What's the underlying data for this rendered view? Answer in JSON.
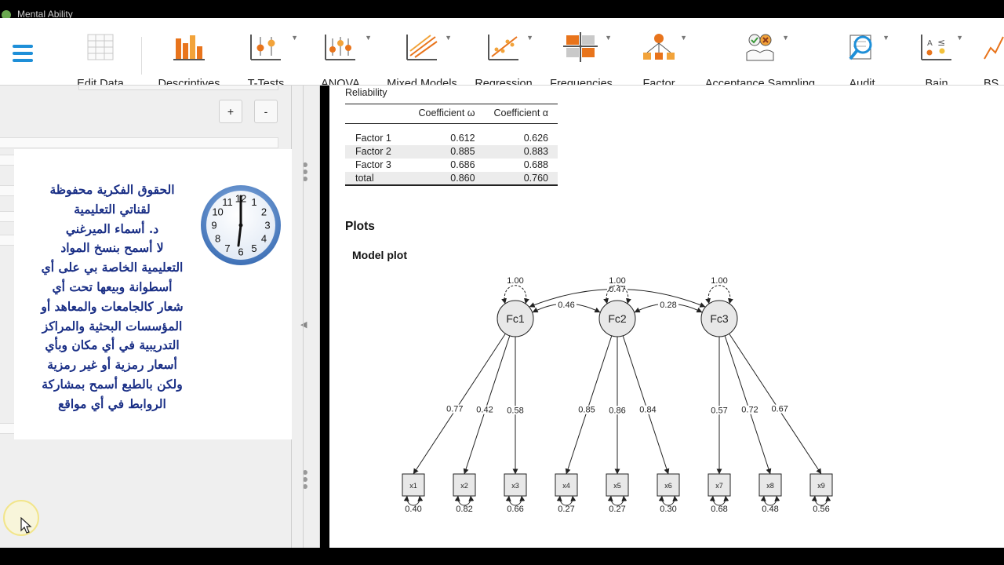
{
  "window": {
    "title": "Mental Ability"
  },
  "ribbon": {
    "edit_data": "Edit Data",
    "items": [
      {
        "key": "descriptives",
        "label": "Descriptives",
        "has_caret": false
      },
      {
        "key": "t-tests",
        "label": "T-Tests",
        "has_caret": true
      },
      {
        "key": "anova",
        "label": "ANOVA",
        "has_caret": true
      },
      {
        "key": "mixed-models",
        "label": "Mixed Models",
        "has_caret": true
      },
      {
        "key": "regression",
        "label": "Regression",
        "has_caret": true
      },
      {
        "key": "frequencies",
        "label": "Frequencies",
        "has_caret": true
      },
      {
        "key": "factor",
        "label": "Factor",
        "has_caret": true
      },
      {
        "key": "acceptance-sampling",
        "label": "Acceptance Sampling",
        "has_caret": true
      },
      {
        "key": "audit",
        "label": "Audit",
        "has_caret": true
      },
      {
        "key": "bain",
        "label": "Bain",
        "has_caret": true
      },
      {
        "key": "bsts",
        "label": "BS",
        "has_caret": false
      }
    ],
    "accent_color": "#1e8fd8",
    "icon_orange": "#e8741c"
  },
  "left_panel": {
    "plus_label": "+",
    "minus_label": "-",
    "overlay_lines": [
      "الحقوق الفكرية محفوظة",
      "لقناتي التعليمية",
      "د. أسماء الميرغني",
      "لا أسمح بنسخ المواد",
      "التعليمية الخاصة بي على أي",
      "أسطوانة وبيعها تحت أي",
      "شعار كالجامعات والمعاهد أو",
      "المؤسسات البحثية والمراكز",
      "التدريبية في أي مكان وبأي",
      "أسعار رمزية أو غير رمزية",
      "ولكن بالطبع أسمح بمشاركة",
      "الروابط في أي مواقع"
    ],
    "overlay_color": "#1a2f86",
    "clock_numbers": [
      "12",
      "1",
      "2",
      "3",
      "4",
      "5",
      "6",
      "7",
      "8",
      "9",
      "10",
      "11"
    ]
  },
  "results": {
    "table_title": "Reliability",
    "columns": [
      "",
      "Coefficient ω",
      "Coefficient α"
    ],
    "rows": [
      {
        "name": "Factor 1",
        "omega": "0.612",
        "alpha": "0.626"
      },
      {
        "name": "Factor 2",
        "omega": "0.885",
        "alpha": "0.883"
      },
      {
        "name": "Factor 3",
        "omega": "0.686",
        "alpha": "0.688"
      },
      {
        "name": "total",
        "omega": "0.860",
        "alpha": "0.760"
      }
    ],
    "plots_heading": "Plots",
    "model_plot_heading": "Model plot"
  },
  "model": {
    "factors": [
      {
        "id": "Fc1",
        "variance": "1.00"
      },
      {
        "id": "Fc2",
        "variance": "1.00"
      },
      {
        "id": "Fc3",
        "variance": "1.00"
      }
    ],
    "covariances": [
      {
        "from": "Fc1",
        "to": "Fc2",
        "value": "0.46"
      },
      {
        "from": "Fc2",
        "to": "Fc3",
        "value": "0.28"
      },
      {
        "from": "Fc1",
        "to": "Fc3",
        "value": "0.47"
      }
    ],
    "indicators": [
      {
        "id": "x1",
        "factor": "Fc1",
        "loading": "0.77",
        "residual": "0.40"
      },
      {
        "id": "x2",
        "factor": "Fc1",
        "loading": "0.42",
        "residual": "0.82"
      },
      {
        "id": "x3",
        "factor": "Fc1",
        "loading": "0.58",
        "residual": "0.66"
      },
      {
        "id": "x4",
        "factor": "Fc2",
        "loading": "0.85",
        "residual": "0.27"
      },
      {
        "id": "x5",
        "factor": "Fc2",
        "loading": "0.86",
        "residual": "0.27"
      },
      {
        "id": "x6",
        "factor": "Fc2",
        "loading": "0.84",
        "residual": "0.30"
      },
      {
        "id": "x7",
        "factor": "Fc3",
        "loading": "0.57",
        "residual": "0.68"
      },
      {
        "id": "x8",
        "factor": "Fc3",
        "loading": "0.72",
        "residual": "0.48"
      },
      {
        "id": "x9",
        "factor": "Fc3",
        "loading": "0.67",
        "residual": "0.56"
      }
    ]
  }
}
